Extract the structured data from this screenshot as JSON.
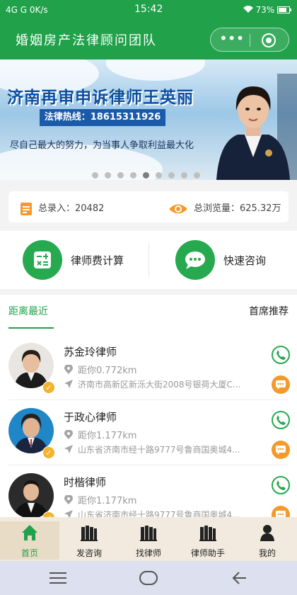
{
  "status_bar": {
    "left": "4G  G  0K/s",
    "time": "15:42",
    "battery": "73%"
  },
  "app": {
    "title": "婚姻房产法律顾问团队",
    "accent": "#20a14a"
  },
  "banner": {
    "headline": "济南再审申诉律师王英丽",
    "hotline": "法律热线：18615311926",
    "slogan": "尽自己最大的努力，为当事人争取利益最大化",
    "slide_count": 9,
    "active_slide": 5
  },
  "stats": {
    "total_entries": "总录入：20482",
    "total_views": "总浏览量：625.32万"
  },
  "tools": [
    {
      "label": "律师费计算",
      "icon": "calculator-icon"
    },
    {
      "label": "快速咨询",
      "icon": "chat-bubble-icon"
    }
  ],
  "tabs": {
    "nearest": "距离最近",
    "recommended": "首席推荐"
  },
  "lawyers": [
    {
      "name": "苏金玲律师",
      "distance": "距你0.772km",
      "address": "济南市高新区新泺大街2008号银荷大厦C..."
    },
    {
      "name": "于政心律师",
      "distance": "距你1.177km",
      "address": "山东省济南市经十路9777号鲁商国奥城4..."
    },
    {
      "name": "时楷律师",
      "distance": "距你1.177km",
      "address": "山东省济南市经十路9777号鲁商国奥城4..."
    }
  ],
  "bottom_nav": [
    {
      "label": "首页",
      "icon": "home-icon"
    },
    {
      "label": "发咨询",
      "icon": "books-icon"
    },
    {
      "label": "找律师",
      "icon": "books-icon"
    },
    {
      "label": "律师助手",
      "icon": "books-icon"
    },
    {
      "label": "我的",
      "icon": "person-icon"
    }
  ]
}
